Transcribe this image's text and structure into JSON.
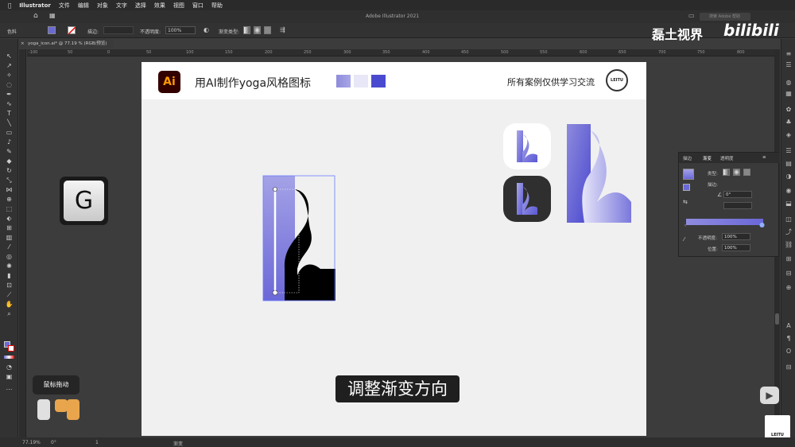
{
  "menubar": {
    "app_name": "Illustrator",
    "items": [
      "文件",
      "编辑",
      "对象",
      "文字",
      "选择",
      "效果",
      "视图",
      "窗口",
      "帮助"
    ]
  },
  "window": {
    "title": "Adobe Illustrator 2021",
    "search_placeholder": "搜索 Adobe 帮助"
  },
  "controlbar": {
    "fill_label": "色料",
    "stroke_label": "描边:",
    "opacity_label": "不透明度:",
    "opacity_value": "100%",
    "gradient_type_label": "渐变类型:"
  },
  "document": {
    "tab_label": "yoga_icon.ai* @ 77.19 % (RGB/预览)"
  },
  "ruler": {
    "h_ticks": [
      "-100",
      "50",
      "0",
      "50",
      "100",
      "150",
      "200",
      "250",
      "300",
      "350",
      "400",
      "450",
      "500",
      "550",
      "600",
      "650",
      "700",
      "750",
      "800"
    ]
  },
  "artboard": {
    "logo_text": "Ai",
    "title": "用AI制作yoga风格图标",
    "note": "所有案例仅供学习交流",
    "badge_text": "LEITU",
    "palette": [
      "#8d8bdc",
      "#e8e7f7",
      "#4a4ad0"
    ]
  },
  "overlay": {
    "key_label": "G",
    "mouse_hint": "鼠标拖动",
    "subtitle": "调整渐变方向",
    "watermark": "磊土视界",
    "bilibili": "bilibili",
    "leitu_logo": "LEITU VISION"
  },
  "gradient_panel": {
    "tabs": [
      "描边",
      "渐变",
      "透明度"
    ],
    "type_label": "类型:",
    "stroke_label": "描边:",
    "angle_value": "0°",
    "opacity_label": "不透明度:",
    "opacity_value": "100%",
    "position_label": "位置:",
    "position_value": "100%"
  },
  "statusbar": {
    "zoom": "77.19%",
    "angle": "0°",
    "page": "1",
    "tool_name": "渐变"
  }
}
